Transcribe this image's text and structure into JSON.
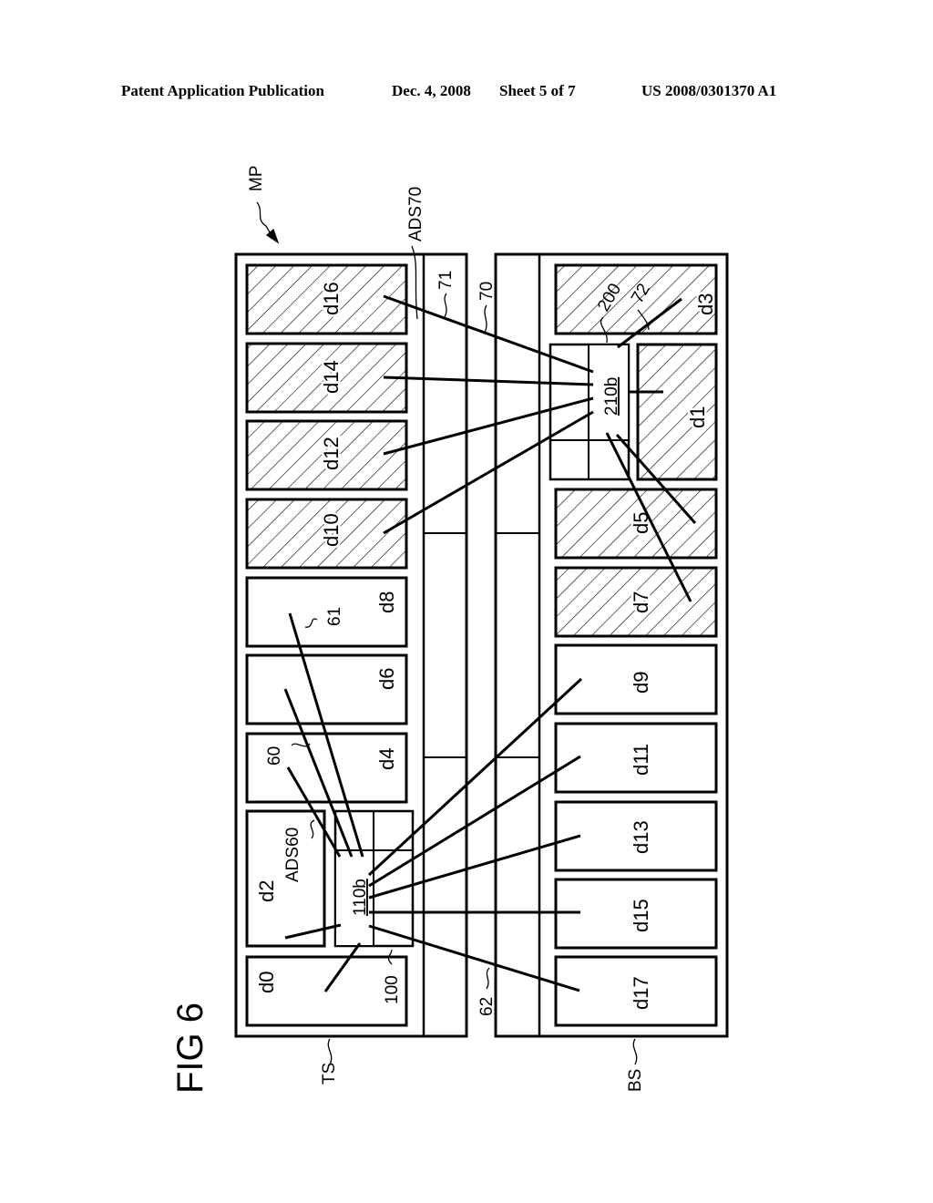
{
  "header": {
    "publication": "Patent Application Publication",
    "date": "Dec. 4, 2008",
    "sheet": "Sheet 5 of 7",
    "number": "US 2008/0301370 A1"
  },
  "figure": {
    "title": "FIG 6",
    "labels": {
      "mp": "MP",
      "ads70": "ADS70",
      "ads60": "ADS60",
      "ref71": "71",
      "ref70": "70",
      "ref72": "72",
      "ref200": "200",
      "ref210b": "210b",
      "ref110b": "110b",
      "ref100": "100",
      "ref60": "60",
      "ref61": "61",
      "ref62": "62",
      "ts": "TS",
      "bs": "BS"
    },
    "top_side_dies": [
      {
        "id": "d0",
        "hatched": false
      },
      {
        "id": "d2",
        "hatched": false
      },
      {
        "id": "d4",
        "hatched": false
      },
      {
        "id": "d6",
        "hatched": false
      },
      {
        "id": "d8",
        "hatched": false
      },
      {
        "id": "d10",
        "hatched": true
      },
      {
        "id": "d12",
        "hatched": true
      },
      {
        "id": "d14",
        "hatched": true
      },
      {
        "id": "d16",
        "hatched": true
      }
    ],
    "bottom_side_dies": [
      {
        "id": "d17",
        "hatched": false
      },
      {
        "id": "d15",
        "hatched": false
      },
      {
        "id": "d13",
        "hatched": false
      },
      {
        "id": "d11",
        "hatched": false
      },
      {
        "id": "d9",
        "hatched": false
      },
      {
        "id": "d7",
        "hatched": true
      },
      {
        "id": "d5",
        "hatched": true
      },
      {
        "id": "d1",
        "hatched": true
      },
      {
        "id": "d3",
        "hatched": true
      }
    ]
  }
}
